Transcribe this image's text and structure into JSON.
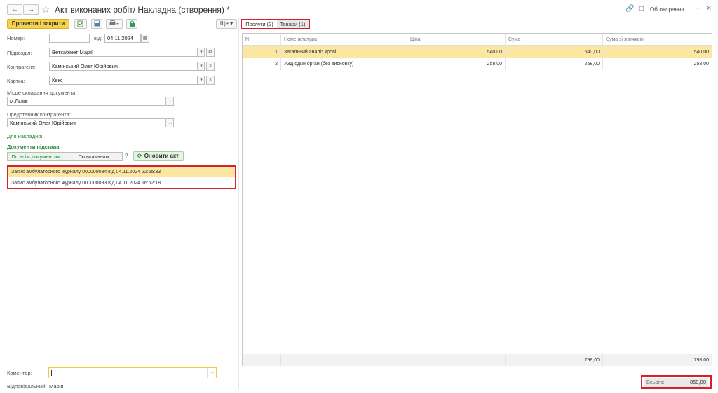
{
  "header": {
    "back_icon": "arrow-left-icon",
    "forward_icon": "arrow-right-icon",
    "title": "Акт виконаних робіт/ Накладна (створення) *",
    "discussions": "Обговорення"
  },
  "toolbar": {
    "post_close": "Провести і закрити",
    "more": "Ще ▾"
  },
  "form": {
    "number_label": "Номер:",
    "number_value": "",
    "date_label": "від:",
    "date_value": "04.11.2024",
    "division_label": "Підрозділ:",
    "division_value": "Веткабінет Марії",
    "contractor_label": "Контрагент:",
    "contractor_value": "Камінський Олег Юрійович",
    "card_label": "Картка:",
    "card_value": "Кекс",
    "place_label": "Місце складання документа:",
    "place_value": "м.Львів",
    "rep_label": "Представник контрагента:",
    "rep_value": "Камінський Олег Юрійович",
    "invoice_link": "Для накладної",
    "basis_title": "Документи підстава",
    "seg_all": "По всім документам",
    "seg_selected": "По вказаним",
    "help": "?",
    "update_button": "Оновити акт",
    "basis_docs": [
      "Запис амбулаторного журналу 000000034 від 04.11.2024 22:55:33",
      "Запис амбулаторного журналу 000000033 від 04.11.2024 16:52:18"
    ],
    "comment_label": "Коментар:",
    "comment_value": "",
    "responsible_label": "Відповідальний:",
    "responsible_value": "Марія"
  },
  "tabs": [
    {
      "label": "Послуги (2)"
    },
    {
      "label": "Товари (1)"
    }
  ],
  "table": {
    "columns": [
      "N",
      "Номенклатура",
      "Ціна",
      "Сума",
      "Сума зі знижкою"
    ],
    "rows": [
      {
        "n": "1",
        "name": "Загальний аналіз крові",
        "price": "540,00",
        "sum": "540,00",
        "sum_disc": "540,00"
      },
      {
        "n": "2",
        "name": "УЗД один орган (без висновку)",
        "price": "258,00",
        "sum": "258,00",
        "sum_disc": "258,00"
      }
    ],
    "footer": {
      "sum": "798,00",
      "sum_disc": "798,00"
    }
  },
  "total": {
    "label": "Всього:",
    "value": "859,00"
  },
  "colors": {
    "accent": "#f5d24a",
    "highlight": "#fbe6a2",
    "green": "#2a8a3a",
    "annotation": "#d6202a"
  }
}
